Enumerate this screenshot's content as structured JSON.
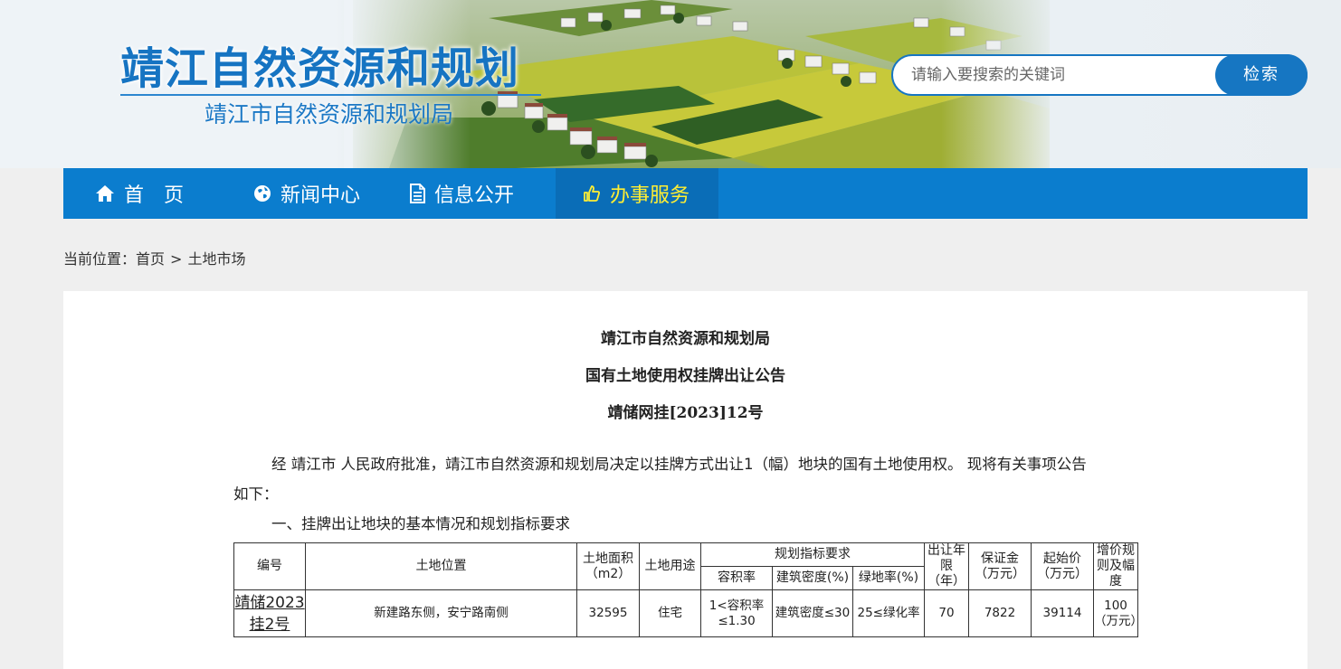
{
  "header": {
    "logo_title": "靖江自然资源和规划",
    "logo_subtitle": "靖江市自然资源和规划局",
    "search_placeholder": "请输入要搜索的关键词",
    "search_button": "检索"
  },
  "nav": {
    "items": [
      {
        "label": "首　页",
        "icon": "home-icon"
      },
      {
        "label": "新闻中心",
        "icon": "globe-icon"
      },
      {
        "label": "信息公开",
        "icon": "document-icon"
      },
      {
        "label": "办事服务",
        "icon": "thumbs-up-icon",
        "active": true
      }
    ]
  },
  "breadcrumb": {
    "prefix": "当前位置：",
    "home": "首页",
    "separator": ">",
    "current": "土地市场"
  },
  "article": {
    "title_line1": "靖江市自然资源和规划局",
    "title_line2": "国有土地使用权挂牌出让公告",
    "title_line3": "靖储网挂[2023]12号",
    "intro_line1": "经 靖江市 人民政府批准，靖江市自然资源和规划局决定以挂牌方式出让1（幅）地块的国有土地使用权。 现将有关事项公告",
    "intro_line2": "如下：",
    "section1": "一、挂牌出让地块的基本情况和规划指标要求"
  },
  "table": {
    "headers": {
      "code": "编号",
      "location": "土地位置",
      "area": "土地面积（m2）",
      "use": "土地用途",
      "planning": "规划指标要求",
      "plot_ratio": "容积率",
      "density": "建筑密度(%)",
      "green": "绿地率(%)",
      "term": "出让年限（年）",
      "deposit": "保证金（万元）",
      "start_price": "起始价（万元）",
      "increment": "增价规则及幅度"
    },
    "rows": [
      {
        "code": "靖储2023挂2号",
        "location": "新建路东侧，安宁路南侧",
        "area": "32595",
        "use": "住宅",
        "plot_ratio": "1<容积率≤1.30",
        "density": "建筑密度≤30",
        "green": "25≤绿化率",
        "term": "70",
        "deposit": "7822",
        "start_price": "39114",
        "increment": "100（万元）"
      }
    ]
  },
  "colors": {
    "brand_blue": "#0b7dce",
    "nav_active_text": "#ffee33"
  }
}
